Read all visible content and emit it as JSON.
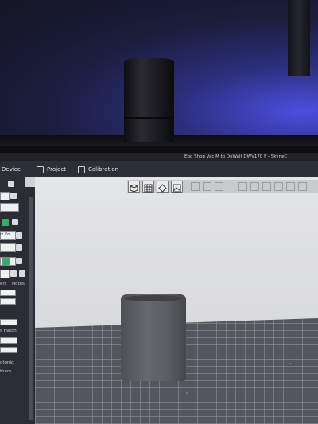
{
  "window": {
    "title": "Ego Shop Vac M to DeWalt DWV170 F - SkyneC"
  },
  "menubar": {
    "device_label": "Device",
    "project_label": "Project",
    "calibration_label": "Calibration"
  },
  "sidebar": {
    "text_fo": "rt Fo",
    "text_ers": "ers",
    "text_notes": "Notes",
    "text_hatch": "s Hatch",
    "text_otonic": "otonic",
    "text_thers": "thers"
  },
  "icons": {
    "cube": "cube-icon",
    "grid": "grid-icon",
    "rotate": "rotate-icon",
    "image": "image-icon"
  }
}
